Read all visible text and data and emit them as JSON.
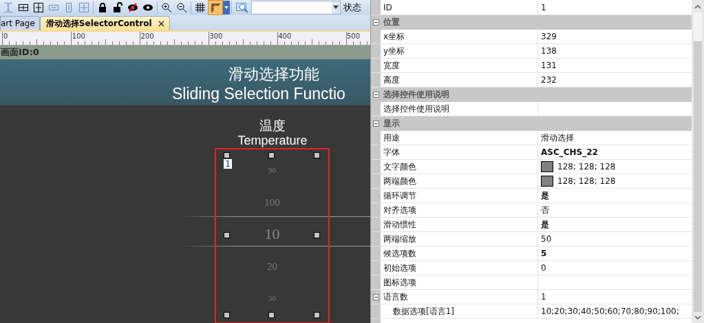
{
  "toolbar": {
    "buttons": [
      {
        "kind": "space-v",
        "selected": false
      },
      {
        "kind": "center-h",
        "selected": false
      },
      {
        "kind": "center-v",
        "selected": false
      },
      {
        "kind": "width",
        "selected": false
      },
      {
        "kind": "height",
        "selected": false
      },
      {
        "kind": "size",
        "selected": false
      },
      {
        "kind": "lock",
        "selected": false
      },
      {
        "kind": "unlock",
        "selected": false
      },
      {
        "kind": "hide",
        "selected": false
      },
      {
        "kind": "show",
        "selected": false
      },
      {
        "kind": "zoom-in",
        "selected": false
      },
      {
        "kind": "zoom-out",
        "selected": false
      },
      {
        "kind": "grid",
        "selected": false
      },
      {
        "kind": "ruler",
        "selected": true
      }
    ],
    "status_label": "状态"
  },
  "tabs": [
    {
      "label": "art Page",
      "selected": false
    },
    {
      "label": "滑动选择SelectorControl",
      "selected": true,
      "close": "×"
    }
  ],
  "ruler": {
    "labels": [
      "0",
      "100",
      "200",
      "300",
      "400",
      "500"
    ]
  },
  "page_bar": {
    "label": "画面ID:0"
  },
  "canvas": {
    "title": "滑动选择功能",
    "subtitle": "Sliding Selection Functio",
    "label_cn": "温度",
    "label_en": "Temperature",
    "selector": {
      "badge": "1",
      "items": [
        {
          "label": "90",
          "selected": false
        },
        {
          "label": "100",
          "selected": false
        },
        {
          "label": "10",
          "selected": true
        },
        {
          "label": "20",
          "selected": false
        },
        {
          "label": "30",
          "selected": false
        }
      ]
    }
  },
  "properties": [
    {
      "kind": "row",
      "name": "ID",
      "value": "1",
      "modified": false
    },
    {
      "kind": "category",
      "name": "位置",
      "expanded": true,
      "children": [
        {
          "kind": "row",
          "name": "x坐标",
          "value": "329",
          "modified": false
        },
        {
          "kind": "row",
          "name": "y坐标",
          "value": "138",
          "modified": false
        },
        {
          "kind": "row",
          "name": "宽度",
          "value": "131",
          "modified": false
        },
        {
          "kind": "row",
          "name": "高度",
          "value": "232",
          "modified": false
        }
      ]
    },
    {
      "kind": "category",
      "name": "选择控件使用说明",
      "expanded": true,
      "children": [
        {
          "kind": "row",
          "name": "选择控件使用说明"
        }
      ]
    },
    {
      "kind": "category",
      "name": "显示",
      "expanded": true,
      "children": [
        {
          "kind": "row",
          "name": "用途",
          "value": "滑动选择",
          "modified": false
        },
        {
          "kind": "row",
          "name": "字体",
          "value": "ASC_CHS_22",
          "modified": true
        },
        {
          "kind": "color",
          "name": "文字颜色",
          "value": "128; 128; 128",
          "color": "#808080",
          "modified": false
        },
        {
          "kind": "color",
          "name": "两端颜色",
          "value": "128; 128; 128",
          "color": "#808080",
          "modified": false
        },
        {
          "kind": "row",
          "name": "循环调节",
          "value": "是",
          "modified": true
        },
        {
          "kind": "row",
          "name": "对齐选项",
          "value": "否",
          "modified": false
        },
        {
          "kind": "row",
          "name": "滑动惯性",
          "value": "是",
          "modified": true
        },
        {
          "kind": "row",
          "name": "两端缩放",
          "value": "50",
          "modified": false
        },
        {
          "kind": "row",
          "name": "候选项数",
          "value": "5",
          "modified": true
        },
        {
          "kind": "row",
          "name": "初始选项",
          "value": "0",
          "modified": false
        },
        {
          "kind": "row",
          "name": "图标选项"
        },
        {
          "kind": "row",
          "name": "语言数",
          "value": "1",
          "modified": false,
          "expanded": true,
          "children": [
            {
              "kind": "row",
              "name": "数据选项[语言1]",
              "value": "10;20;30;40;50;60;70;80;90;100;",
              "modified": false
            }
          ]
        }
      ]
    }
  ]
}
